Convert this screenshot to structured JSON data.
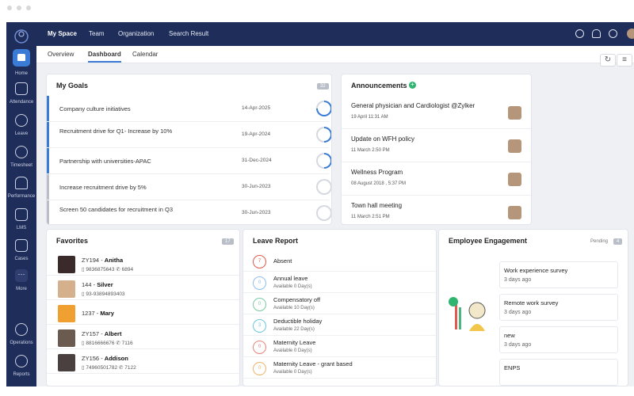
{
  "topnav": {
    "items": [
      "My Space",
      "Team",
      "Organization",
      "Search Result"
    ],
    "active": "My Space"
  },
  "subtabs": {
    "items": [
      "Overview",
      "Dashboard",
      "Calendar"
    ],
    "active": "Dashboard"
  },
  "rail": {
    "items": [
      "Home",
      "Attendance",
      "Leave",
      "Timesheet",
      "Performance",
      "LMS",
      "Cases",
      "More",
      "Operations",
      "Reports"
    ]
  },
  "goals": {
    "title": "My Goals",
    "count": "32",
    "items": [
      {
        "text": "Company culture initiatives",
        "date": "14-Apr-2025",
        "progress": 0.75,
        "bar": "#3a7bd5"
      },
      {
        "text": "Recruitment drive for Q1- Increase by 10%",
        "date": "19-Apr-2024",
        "progress": 0.5,
        "bar": "#3a7bd5"
      },
      {
        "text": "Partnership with universities-APAC",
        "date": "31-Dec-2024",
        "progress": 0.5,
        "bar": "#3a7bd5"
      },
      {
        "text": "Increase recruitment drive by 5%",
        "date": "30-Jun-2023",
        "progress": 0,
        "bar": "#b9bec8"
      },
      {
        "text": "Screen 50 candidates for recruitment in Q3",
        "date": "30-Jun-2023",
        "progress": 0,
        "bar": "#b9bec8"
      }
    ]
  },
  "announcements": {
    "title": "Announcements",
    "items": [
      {
        "title": "General physician and Cardiologist @Zylker",
        "date": "19 April 11:31 AM"
      },
      {
        "title": "Update on WFH policy",
        "date": "11 March 2:50 PM"
      },
      {
        "title": "Wellness Program",
        "date": "08 August 2018 , 5:37 PM"
      },
      {
        "title": "Town hall meeting",
        "date": "11 March 2:51 PM"
      }
    ]
  },
  "favorites": {
    "title": "Favorites",
    "count": "17",
    "items": [
      {
        "id": "ZY194",
        "name": "Anitha",
        "phone": "9836875643",
        "ext": "6894"
      },
      {
        "id": "144",
        "name": "Silver",
        "phone": "93-93894893403",
        "ext": ""
      },
      {
        "id": "1237",
        "name": "Mary",
        "phone": "",
        "ext": ""
      },
      {
        "id": "ZY157",
        "name": "Albert",
        "phone": "8816666676",
        "ext": "7116"
      },
      {
        "id": "ZY156",
        "name": "Addison",
        "phone": "74960501782",
        "ext": "7122"
      }
    ]
  },
  "leave": {
    "title": "Leave Report",
    "items": [
      {
        "name": "Absent",
        "avail": "",
        "count": "7",
        "color": "#e05a4e"
      },
      {
        "name": "Annual leave",
        "avail": "Available 0 Day(s)",
        "count": "0",
        "color": "#6aa9e9"
      },
      {
        "name": "Compensatory off",
        "avail": "Available 10 Day(s)",
        "count": "0",
        "color": "#4cb782"
      },
      {
        "name": "Deductible holiday",
        "avail": "Available 22 Day(s)",
        "count": "3",
        "color": "#39b6d2"
      },
      {
        "name": "Maternity Leave",
        "avail": "Available 0 Day(s)",
        "count": "0",
        "color": "#e05a4e"
      },
      {
        "name": "Maternity Leave - grant based",
        "avail": "Available 0 Day(s)",
        "count": "0",
        "color": "#e89a3c"
      }
    ]
  },
  "engagement": {
    "title": "Employee Engagement",
    "pending_label": "Pending",
    "pending_count": "4",
    "items": [
      {
        "title": "Work experience survey",
        "ago": "3 days ago"
      },
      {
        "title": "Remote work survey",
        "ago": "3 days ago"
      },
      {
        "title": "new",
        "ago": "3 days ago"
      },
      {
        "title": "ENPS",
        "ago": ""
      }
    ]
  }
}
